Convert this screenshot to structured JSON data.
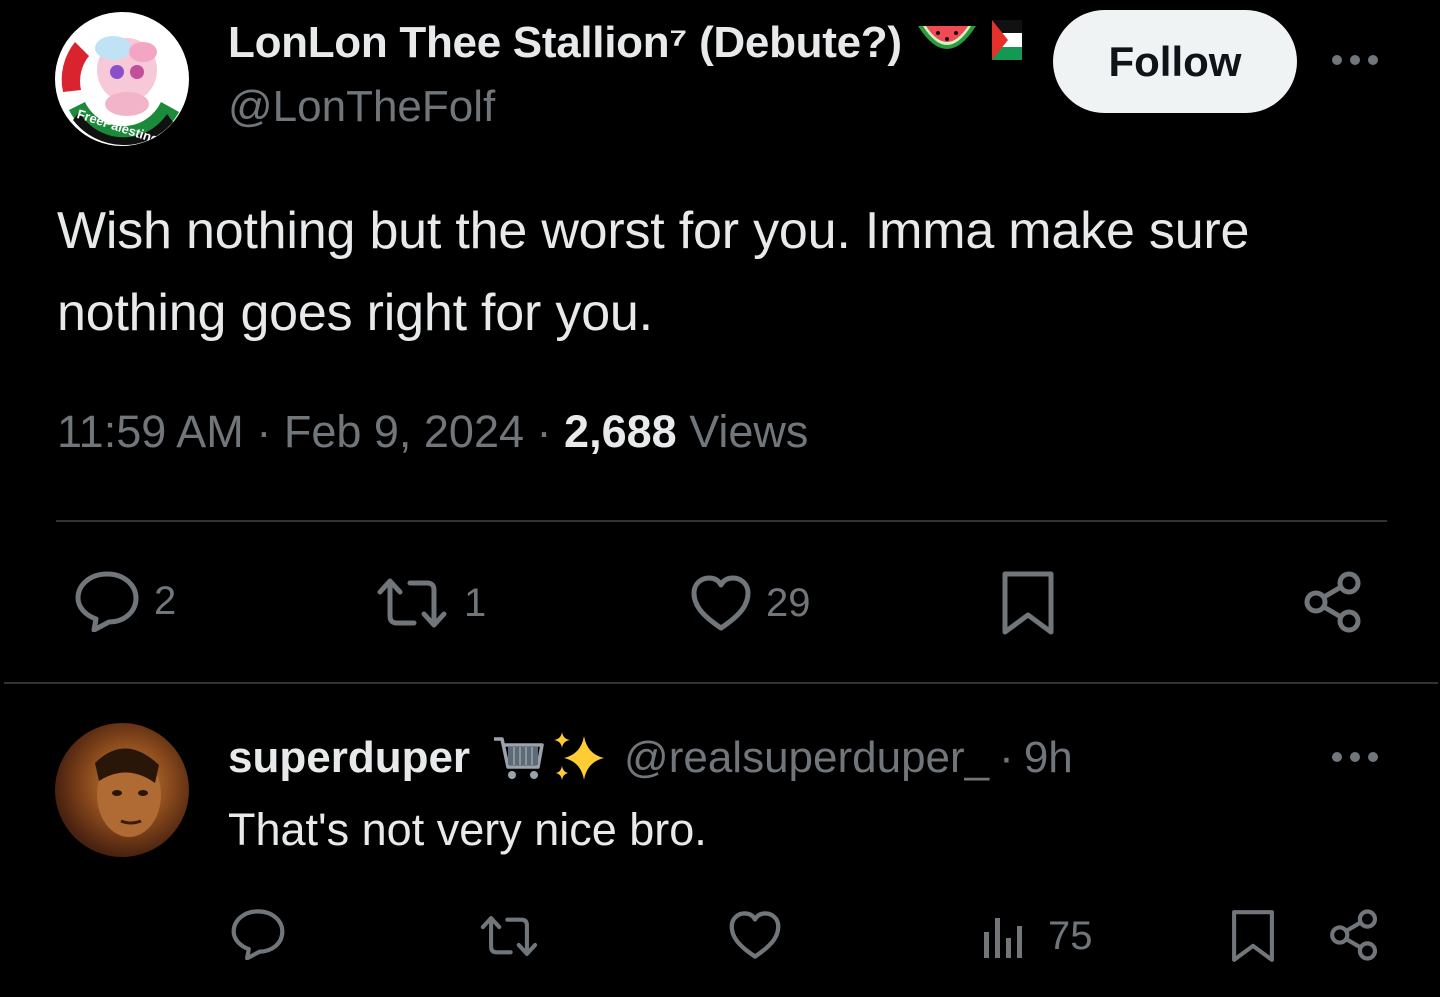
{
  "tweet": {
    "display_name": "LonLon Thee Stallion⁷ (Debute?)",
    "handle": "@LonTheFolf",
    "avatar_ring_text": "FreePalestine!",
    "follow_label": "Follow",
    "text_line1": "Wish nothing but the worst for you. Imma make sure",
    "text_line2": "nothing goes right for you.",
    "time": "11:59 AM",
    "sep": "·",
    "date": "Feb 9, 2024",
    "views_count": "2,688",
    "views_label": "Views",
    "replies": "2",
    "reposts": "1",
    "likes": "29",
    "icons": [
      "watermelon-icon",
      "palestine-flag-icon",
      "more-icon",
      "reply-icon",
      "repost-icon",
      "like-icon",
      "bookmark-icon",
      "share-icon"
    ]
  },
  "reply": {
    "display_name": "superduper",
    "handle": "@realsuperduper_",
    "sep": "·",
    "time": "9h",
    "text": "That's not very nice bro.",
    "views": "75",
    "icons": [
      "shopping-cart-icon",
      "sparkles-icon",
      "more-icon",
      "reply-icon",
      "repost-icon",
      "like-icon",
      "views-icon",
      "bookmark-icon",
      "share-icon"
    ]
  },
  "colors": {
    "background": "#000000",
    "text_primary": "#e7e9ea",
    "text_secondary": "#71767b",
    "divider": "#2f3336",
    "follow_bg": "#eff3f4"
  }
}
